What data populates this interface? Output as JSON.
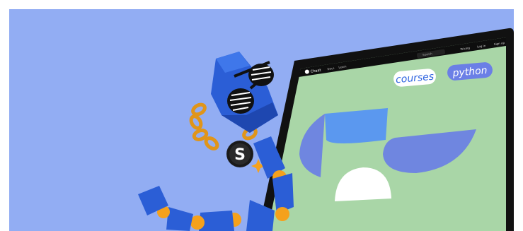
{
  "illustration": {
    "background_color": "#92adf3",
    "screen_color": "#a9d6a7",
    "laptop_color": "#111111",
    "snake_color": "#2b5ed6",
    "accent_orange": "#f5a11c",
    "laptop_nav": {
      "logo_text": "Cheat",
      "nav_items": [
        "Docs",
        "Learn"
      ],
      "search_placeholder": "Search",
      "right_items": [
        "Pricing",
        "Log in",
        "Sign up"
      ]
    },
    "tags": {
      "courses": "courses",
      "python": "python"
    },
    "badge_letter": "S"
  }
}
